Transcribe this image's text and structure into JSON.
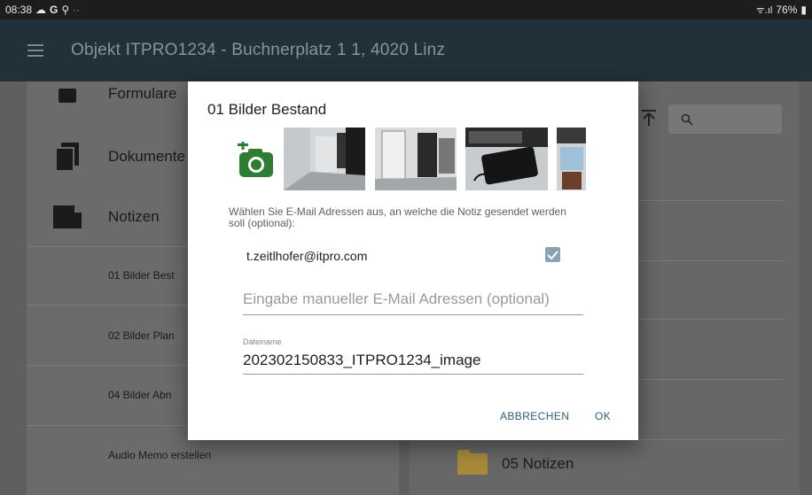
{
  "status_bar": {
    "time": "08:38",
    "left_icons": [
      "cloud-icon",
      "google-icon",
      "location-icon"
    ],
    "dots": "··",
    "signal_text": "ᯤ.ıl",
    "battery_percent": "76%"
  },
  "app_bar": {
    "title": "Objekt ITPRO1234 - Buchnerplatz 1 1, 4020 Linz"
  },
  "left_panel": {
    "items": [
      {
        "label": "Formulare"
      },
      {
        "label": "Dokumente"
      },
      {
        "label": "Notizen"
      }
    ],
    "sub_items": [
      {
        "label": "01 Bilder Best"
      },
      {
        "label": "02 Bilder Plan"
      },
      {
        "label": "04 Bilder Abn"
      },
      {
        "label": "Audio Memo erstellen"
      }
    ]
  },
  "right_panel": {
    "folder_label": "05 Notizen"
  },
  "dialog": {
    "title": "01 Bilder Bestand",
    "hint": "Wählen Sie E-Mail Adressen aus, an welche die Notiz gesendet werden soll (optional):",
    "email": "t.zeitlhofer@itpro.com",
    "email_checked": true,
    "manual_placeholder": "Eingabe manueller E-Mail Adressen (optional)",
    "filename_label": "Dateiname",
    "filename_value": "202302150833_ITPRO1234_image",
    "cancel_label": "ABBRECHEN",
    "ok_label": "OK",
    "photos": [
      "photo-hallway",
      "photo-door",
      "photo-laptop",
      "photo-partial"
    ]
  },
  "colors": {
    "app_bar": "#22303a",
    "accent_button": "#2e5d78",
    "camera_green": "#2e7d32"
  }
}
